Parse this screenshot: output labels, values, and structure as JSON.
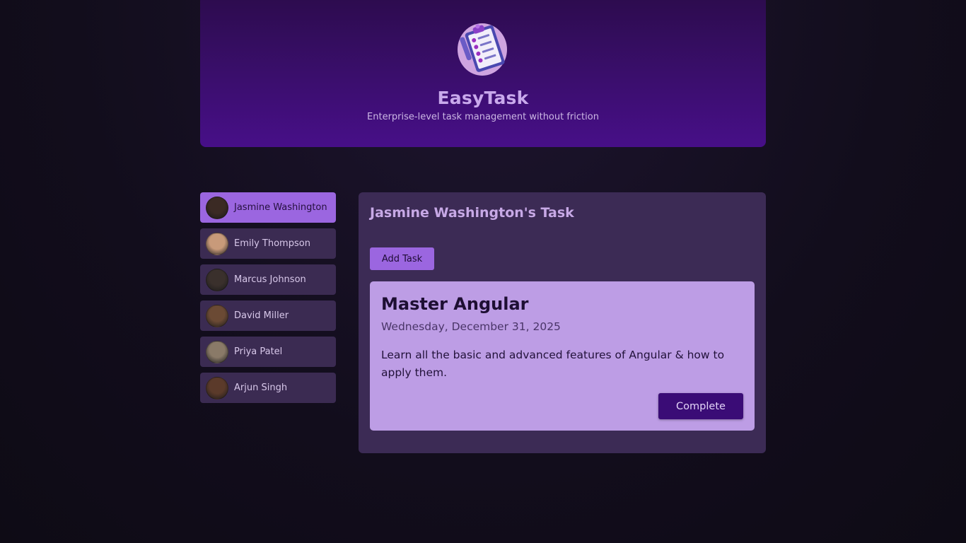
{
  "header": {
    "logo_icon": "clipboard-checklist-icon",
    "title": "EasyTask",
    "subtitle": "Enterprise-level task management without friction"
  },
  "users": [
    {
      "name": "Jasmine Washington",
      "selected": true,
      "avatar_color": "#3b2a24"
    },
    {
      "name": "Emily Thompson",
      "selected": false,
      "avatar_color": "#c89a7a"
    },
    {
      "name": "Marcus Johnson",
      "selected": false,
      "avatar_color": "#3a302c"
    },
    {
      "name": "David Miller",
      "selected": false,
      "avatar_color": "#6b4a34"
    },
    {
      "name": "Priya Patel",
      "selected": false,
      "avatar_color": "#8a7a68"
    },
    {
      "name": "Arjun Singh",
      "selected": false,
      "avatar_color": "#5b3a2a"
    }
  ],
  "tasks_panel": {
    "title": "Jasmine Washington's Task",
    "add_task_label": "Add Task",
    "tasks": [
      {
        "title": "Master Angular",
        "date": "Wednesday, December 31, 2025",
        "description": "Learn all the basic and advanced features of Angular & how to apply them.",
        "complete_label": "Complete"
      }
    ]
  },
  "colors": {
    "accent": "#9b66e0",
    "header_top": "#2d0c4f",
    "header_bottom": "#470f88",
    "panel": "#3c2b55",
    "card": "#bd9de5",
    "complete_button": "#3a0c76"
  }
}
